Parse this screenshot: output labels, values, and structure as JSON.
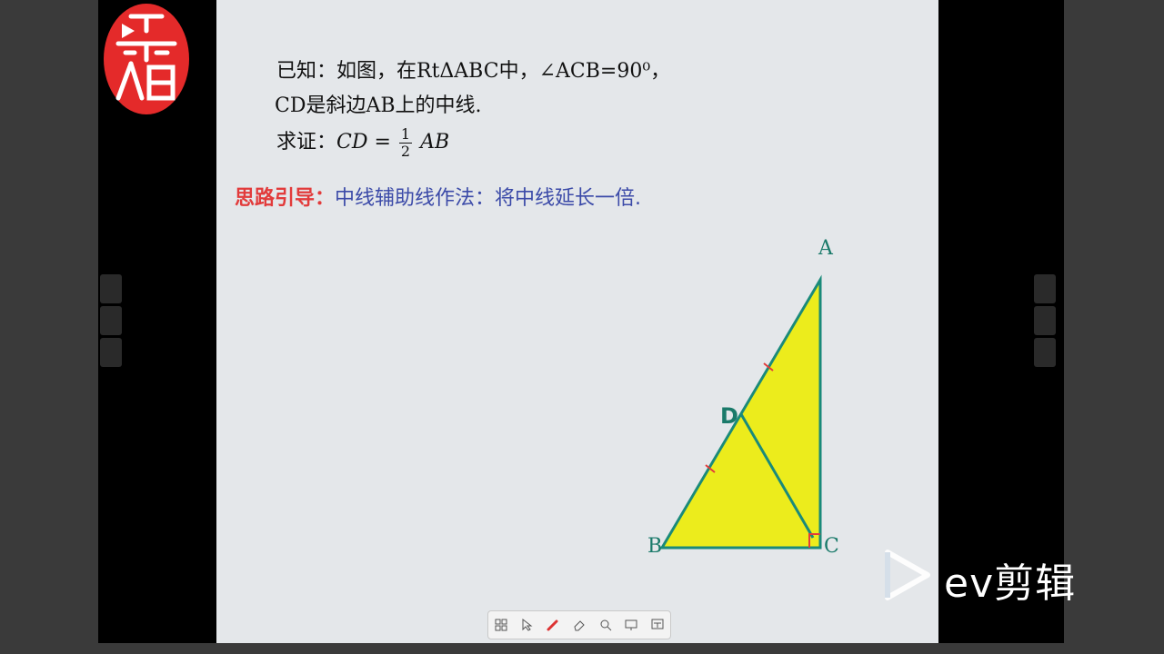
{
  "problem": {
    "given_line1": "已知：如图，在RtΔABC中，∠ACB=90⁰，",
    "given_line2": "CD是斜边AB上的中线.",
    "prove_prefix": "求证：",
    "prove_lhs": "CD =",
    "frac_num": "1",
    "frac_den": "2",
    "prove_rhs": "AB"
  },
  "hint": {
    "label": "思路引导：",
    "text": "中线辅助线作法：将中线延长一倍."
  },
  "figure": {
    "labels": {
      "A": "A",
      "B": "B",
      "C": "C",
      "D": "D"
    },
    "fill_color": "#ecec1c",
    "stroke_color": "#1a8a7a"
  },
  "toolbar": {
    "icons": [
      "grid-icon",
      "pointer-icon",
      "pen-icon",
      "eraser-icon",
      "magnifier-icon",
      "board-icon",
      "blackboard-icon"
    ]
  },
  "watermark": {
    "text": "ev剪辑"
  },
  "colors": {
    "hint_label": "#e23b3b",
    "hint_text": "#3b4aa8",
    "logo_red": "#e42a2a"
  }
}
